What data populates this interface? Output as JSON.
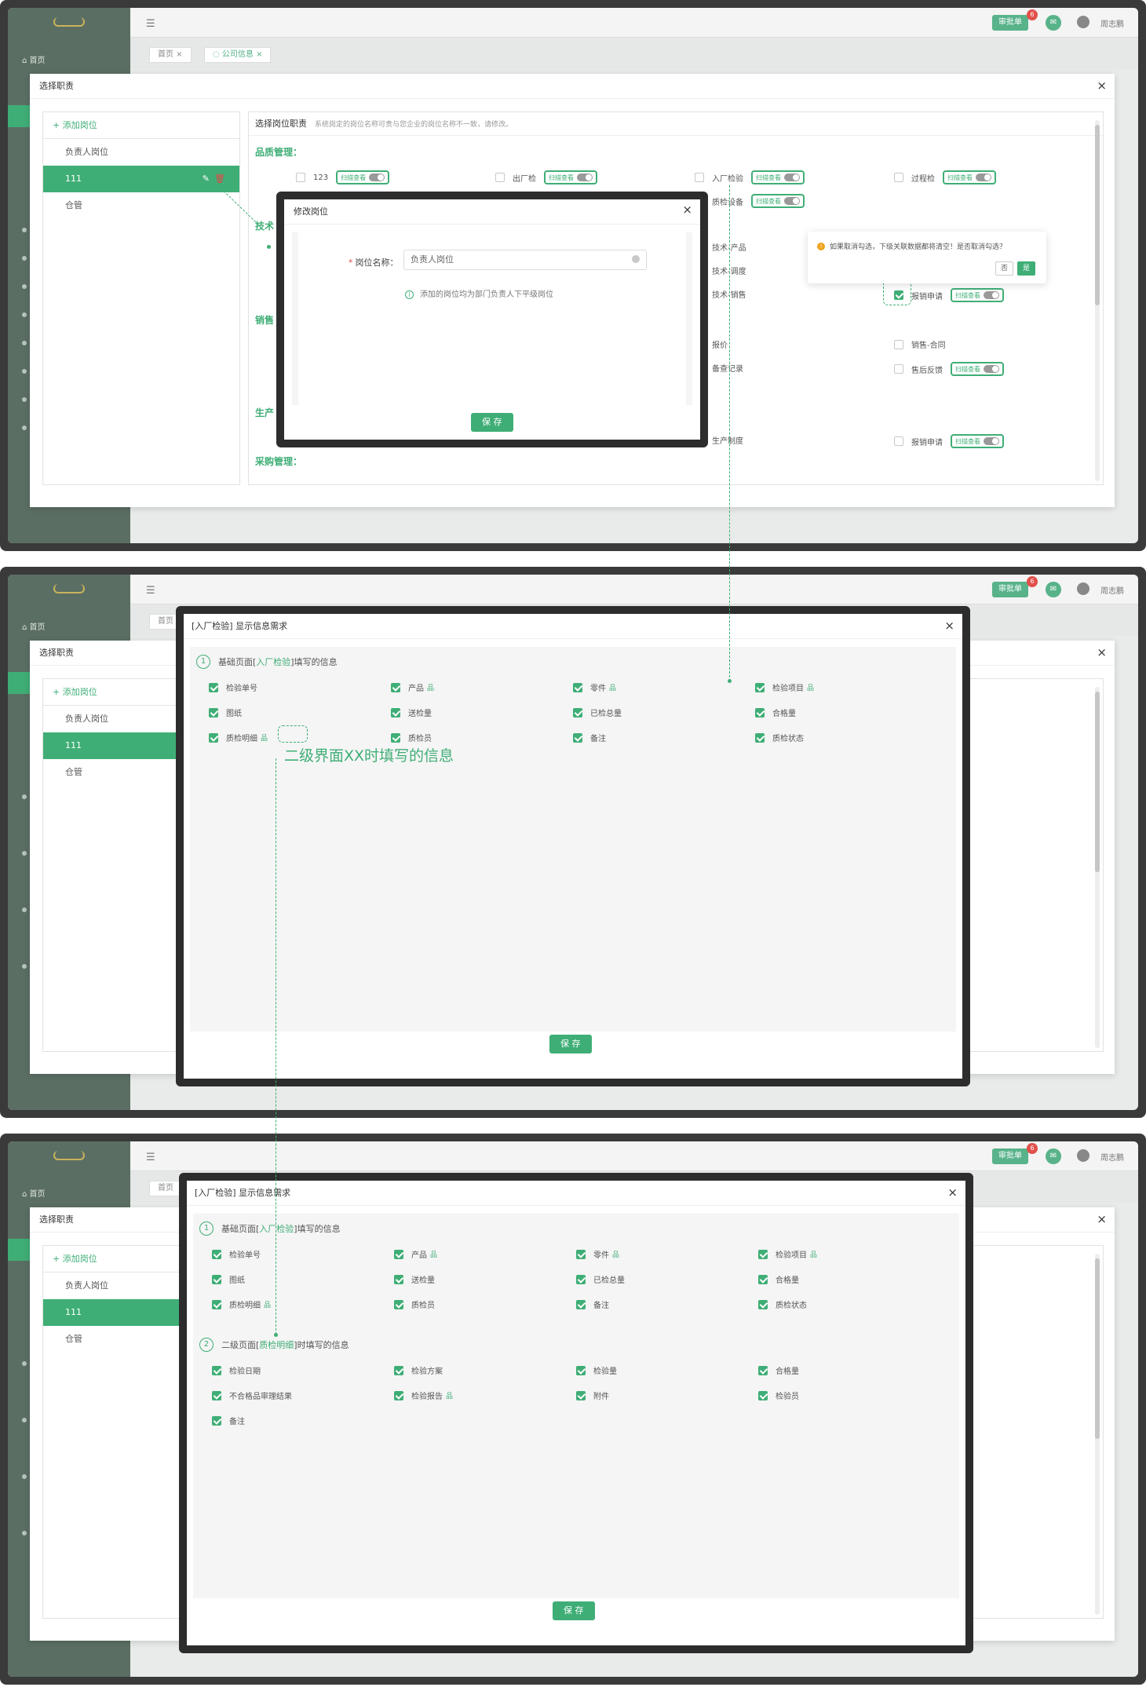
{
  "app": {
    "home_label": "首页",
    "approve_label": "审批单",
    "badge_count": "6",
    "user_name": "周志鹏",
    "tab_home": "首页",
    "tab_company": "公司信息"
  },
  "panel1": {
    "dialog_title": "选择职责",
    "add_position": "+ 添加岗位",
    "positions": [
      "负责人岗位",
      "111",
      "仓管"
    ],
    "select_title": "选择岗位职责",
    "select_hint": "系统岗定的岗位名称可贵与您企业的岗位名称不一致，请修改。",
    "sections": [
      "品质管理：",
      "技术",
      "销售",
      "生产",
      "采购管理："
    ],
    "toggle_label": "扫描查看",
    "options": {
      "o123": "123",
      "outbound": "出厂检",
      "incoming": "入厂检验",
      "process": "过程检",
      "qc_equip": "质检设备",
      "tech_product": "技术-产品",
      "tech_schedule": "技术-调度",
      "tech_sales": "技术-销售",
      "report": "报销申请",
      "quote": "报价",
      "sales_contract": "销售-合同",
      "backup": "备查记录",
      "aftersale": "售后反馈",
      "prod_system": "生产制度",
      "report2": "报销申请"
    },
    "popconfirm": {
      "msg": "如果取消勾选，下级关联数据都将清空！是否取消勾选？",
      "no": "否",
      "yes": "是"
    },
    "edit_modal": {
      "title": "修改岗位",
      "label": "岗位名称：",
      "value": "负责人岗位",
      "tip": "添加的岗位均为部门负责人下平级岗位",
      "save": "保 存"
    }
  },
  "panel2": {
    "modal_title": "[入厂检验] 显示信息需求",
    "step1_prefix": "基础页面[",
    "step1_hl": "入厂检验",
    "step1_suffix": "]填写的信息",
    "fields": [
      {
        "label": "检验单号",
        "sub": false
      },
      {
        "label": "产品",
        "sub": true
      },
      {
        "label": "零件",
        "sub": true
      },
      {
        "label": "检验项目",
        "sub": true
      },
      {
        "label": "图纸",
        "sub": false
      },
      {
        "label": "送检量",
        "sub": false
      },
      {
        "label": "已检总量",
        "sub": false
      },
      {
        "label": "合格量",
        "sub": false
      },
      {
        "label": "质检明细",
        "sub": true
      },
      {
        "label": "质检员",
        "sub": false
      },
      {
        "label": "备注",
        "sub": false
      },
      {
        "label": "质检状态",
        "sub": false
      }
    ],
    "annotation": "二级界面XX时填写的信息",
    "save": "保 存"
  },
  "panel3": {
    "modal_title": "[入厂检验] 显示信息需求",
    "step1_prefix": "基础页面[",
    "step1_hl": "入厂检验",
    "step1_suffix": "]填写的信息",
    "step2_prefix": "二级页面[",
    "step2_hl": "质检明细",
    "step2_suffix": "]时填写的信息",
    "fields2": [
      {
        "label": "检验日期",
        "sub": false
      },
      {
        "label": "检验方案",
        "sub": false
      },
      {
        "label": "检验量",
        "sub": false
      },
      {
        "label": "合格量",
        "sub": false
      },
      {
        "label": "不合格品审理结果",
        "sub": false
      },
      {
        "label": "检验报告",
        "sub": true
      },
      {
        "label": "附件",
        "sub": false
      },
      {
        "label": "检验员",
        "sub": false
      },
      {
        "label": "备注",
        "sub": false
      }
    ],
    "save": "保 存"
  },
  "sub_icon": "品",
  "colors": {
    "accent": "#3fae76",
    "frame": "#2d2d2d",
    "danger": "#e04a4a",
    "warning": "#f0a41d"
  }
}
